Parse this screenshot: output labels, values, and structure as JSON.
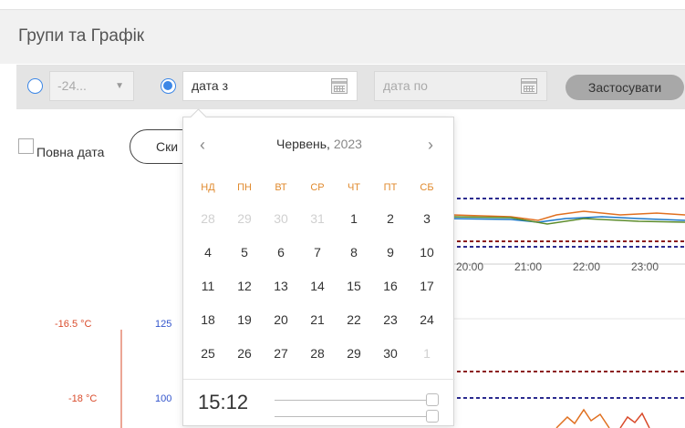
{
  "header": {
    "title": "Групи та Графік"
  },
  "toolbar": {
    "period_select": {
      "value": "-24...",
      "arrow": "▼"
    },
    "date_from": {
      "value": "дата з"
    },
    "date_to": {
      "placeholder": "дата по"
    },
    "apply_label": "Застосувати"
  },
  "options": {
    "full_date_label": "Повна дата",
    "reset_label": "Ски"
  },
  "datepicker": {
    "prev": "‹",
    "next": "›",
    "month": "Червень,",
    "year": "2023",
    "weekdays": [
      "НД",
      "ПН",
      "ВТ",
      "СР",
      "ЧТ",
      "ПТ",
      "СБ"
    ],
    "weeks": [
      [
        "28",
        "29",
        "30",
        "31",
        "1",
        "2",
        "3"
      ],
      [
        "4",
        "5",
        "6",
        "7",
        "8",
        "9",
        "10"
      ],
      [
        "11",
        "12",
        "13",
        "14",
        "15",
        "16",
        "17"
      ],
      [
        "18",
        "19",
        "20",
        "21",
        "22",
        "23",
        "24"
      ],
      [
        "25",
        "26",
        "27",
        "28",
        "29",
        "30",
        "1"
      ]
    ],
    "time": "15:12"
  },
  "chart": {
    "time_ticks": [
      "20:00",
      "21:00",
      "22:00",
      "23:00"
    ],
    "temp_labels": [
      "-16.5 °C",
      "-18 °C"
    ],
    "value_labels": [
      "125",
      "100"
    ]
  },
  "colors": {
    "accent": "#3d87e6",
    "weekday": "#e08a2e",
    "temp_axis": "#d94b2b",
    "value_axis": "#3355cc"
  }
}
